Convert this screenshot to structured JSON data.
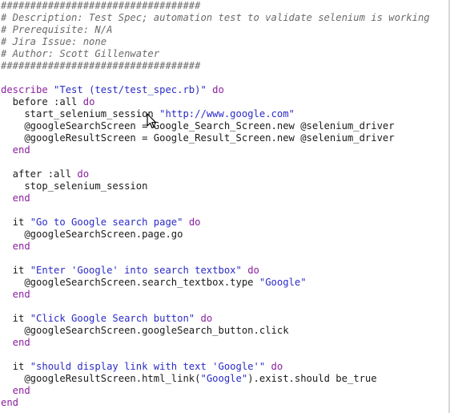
{
  "editor": {
    "lines": [
      [
        {
          "t": "c",
          "v": "##################################"
        }
      ],
      [
        {
          "t": "c",
          "v": "# Description: Test Spec; automation test to validate selenium is working"
        }
      ],
      [
        {
          "t": "c",
          "v": "# Prerequisite: N/A"
        }
      ],
      [
        {
          "t": "c",
          "v": "# Jira Issue: none"
        }
      ],
      [
        {
          "t": "c",
          "v": "# Author: Scott Gillenwater"
        }
      ],
      [
        {
          "t": "c",
          "v": "##################################"
        }
      ],
      [],
      [
        {
          "t": "k",
          "v": "describe"
        },
        {
          "t": "n",
          "v": " "
        },
        {
          "t": "s",
          "v": "\"Test (test/test_spec.rb)\""
        },
        {
          "t": "n",
          "v": " "
        },
        {
          "t": "k",
          "v": "do"
        }
      ],
      [
        {
          "t": "n",
          "v": "  before :all "
        },
        {
          "t": "k",
          "v": "do"
        }
      ],
      [
        {
          "t": "n",
          "v": "    start_selenium_session "
        },
        {
          "t": "s",
          "v": "\"http://www.google.com\""
        }
      ],
      [
        {
          "t": "n",
          "v": "    @googleSearchScreen = Google_Search_Screen.new @selenium_driver"
        }
      ],
      [
        {
          "t": "n",
          "v": "    @googleResultScreen = Google_Result_Screen.new @selenium_driver"
        }
      ],
      [
        {
          "t": "k",
          "v": "  end"
        }
      ],
      [],
      [
        {
          "t": "n",
          "v": "  after :all "
        },
        {
          "t": "k",
          "v": "do"
        }
      ],
      [
        {
          "t": "n",
          "v": "    stop_selenium_session"
        }
      ],
      [
        {
          "t": "k",
          "v": "  end"
        }
      ],
      [],
      [
        {
          "t": "n",
          "v": "  it "
        },
        {
          "t": "s",
          "v": "\"Go to Google search page\""
        },
        {
          "t": "n",
          "v": " "
        },
        {
          "t": "k",
          "v": "do"
        }
      ],
      [
        {
          "t": "n",
          "v": "    @googleSearchScreen.page.go"
        }
      ],
      [
        {
          "t": "k",
          "v": "  end"
        }
      ],
      [],
      [
        {
          "t": "n",
          "v": "  it "
        },
        {
          "t": "s",
          "v": "\"Enter 'Google' into search textbox\""
        },
        {
          "t": "n",
          "v": " "
        },
        {
          "t": "k",
          "v": "do"
        }
      ],
      [
        {
          "t": "n",
          "v": "    @googleSearchScreen.search_textbox.type "
        },
        {
          "t": "s",
          "v": "\"Google\""
        }
      ],
      [
        {
          "t": "k",
          "v": "  end"
        }
      ],
      [],
      [
        {
          "t": "n",
          "v": "  it "
        },
        {
          "t": "s",
          "v": "\"Click Google Search button\""
        },
        {
          "t": "n",
          "v": " "
        },
        {
          "t": "k",
          "v": "do"
        }
      ],
      [
        {
          "t": "n",
          "v": "    @googleSearchScreen.googleSearch_button.click"
        }
      ],
      [
        {
          "t": "k",
          "v": "  end"
        }
      ],
      [],
      [
        {
          "t": "n",
          "v": "  it "
        },
        {
          "t": "s",
          "v": "\"should display link with text 'Google'\""
        },
        {
          "t": "n",
          "v": " "
        },
        {
          "t": "k",
          "v": "do"
        }
      ],
      [
        {
          "t": "n",
          "v": "    @googleResultScreen.html_link("
        },
        {
          "t": "s",
          "v": "\"Google\""
        },
        {
          "t": "n",
          "v": ").exist.should be_true"
        }
      ],
      [
        {
          "t": "k",
          "v": "  end"
        }
      ],
      [
        {
          "t": "k",
          "v": "end"
        }
      ]
    ]
  },
  "cursor": {
    "icon": "mouse-pointer-icon"
  }
}
